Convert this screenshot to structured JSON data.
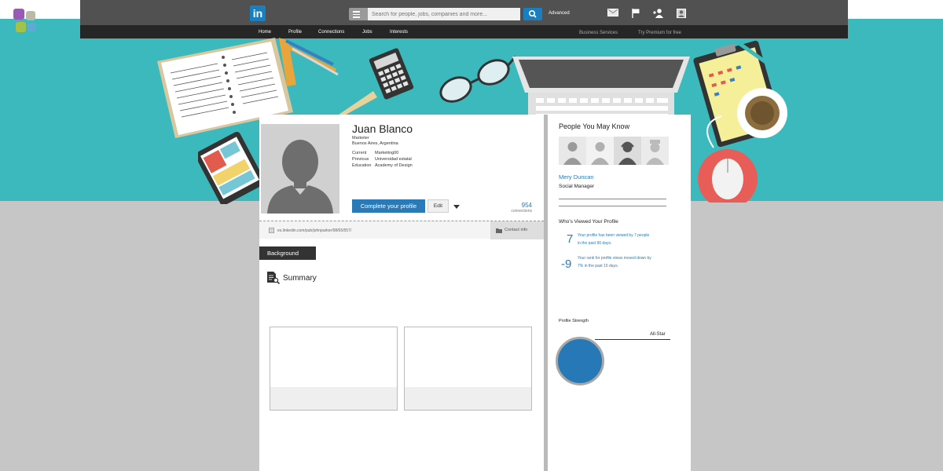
{
  "colors": {
    "teal": "#3bb9bd",
    "linkedin_blue": "#1a7fc1",
    "accent_blue": "#2a7ab8",
    "topbar": "#515151",
    "subnav": "#262626",
    "corner_squares": [
      "#9b59b6",
      "#bdb9a8",
      "#a3c24a",
      "#5fa9d6"
    ]
  },
  "topbar": {
    "logo": "in",
    "search_placeholder": "Search for people, jobs, companies and more...",
    "advanced_label": "Advanced",
    "icons": [
      "message-icon",
      "flag-icon",
      "add-connection-icon",
      "account-icon"
    ]
  },
  "subnav": {
    "items": [
      "Home",
      "Profile",
      "Connections",
      "Jobs",
      "Interests"
    ],
    "business_services": "Business Services",
    "premium": "Try Premium for free"
  },
  "profile": {
    "name": "Juan Blanco",
    "title": "Marketer",
    "location": "Buenos Aires, Argentina",
    "details": [
      {
        "label": "Current",
        "value": "Marketing00"
      },
      {
        "label": "Previous",
        "value": "Universidad estatal"
      },
      {
        "label": "Education",
        "value": "Academy of Design"
      }
    ],
    "complete_button": "Complete your profile",
    "edit_button": "Edit",
    "connections_count": "954",
    "connections_label": "connections",
    "url": "es.linkedin.com/pub/johnparker/98/65/557/",
    "contact_info": "Contact info"
  },
  "sections": {
    "background_tab": "Background",
    "summary_heading": "Summary"
  },
  "sidebar": {
    "pymk_heading": "People You May Know",
    "person_name": "Mery Duncan",
    "person_title": "Social Manager",
    "viewed_heading": "Who's Viewed Your Profile",
    "stats": [
      {
        "number": "7",
        "text": "Your profile has been viewed by 7 people in the past 90 days."
      },
      {
        "number": "-9",
        "text": "Your rank for profile views moved down by 7% in the past 15 days."
      }
    ],
    "strength_label": "Profile Strength",
    "strength_level": "All-Star"
  }
}
